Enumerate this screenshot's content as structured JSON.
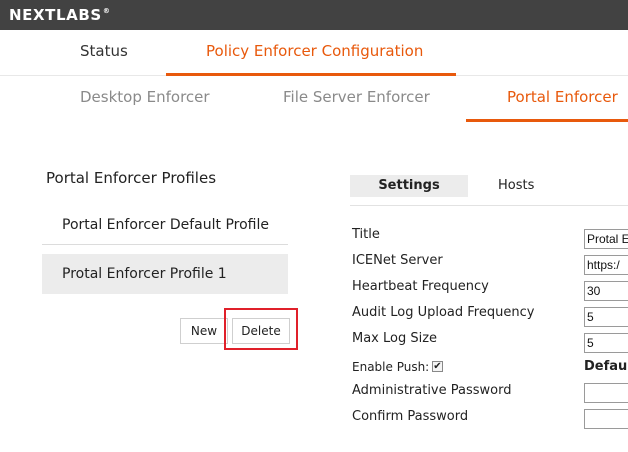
{
  "header": {
    "logo_text": "NEXTLABS",
    "logo_trademark": "®"
  },
  "main_tabs": [
    {
      "label": "Status",
      "active": false
    },
    {
      "label": "Policy Enforcer Configuration",
      "active": true
    }
  ],
  "sub_tabs": [
    {
      "label": "Desktop Enforcer",
      "active": false
    },
    {
      "label": "File Server Enforcer",
      "active": false
    },
    {
      "label": "Portal Enforcer",
      "active": true
    }
  ],
  "profiles": {
    "title": "Portal Enforcer Profiles",
    "items": [
      {
        "label": "Portal Enforcer Default Profile",
        "selected": false
      },
      {
        "label": "Protal Enforcer Profile 1",
        "selected": true
      }
    ],
    "new_label": "New",
    "delete_label": "Delete"
  },
  "settings": {
    "tabs": [
      {
        "label": "Settings",
        "active": true
      },
      {
        "label": "Hosts",
        "active": false
      }
    ],
    "fields": [
      {
        "label": "Title",
        "value": "Protal E"
      },
      {
        "label": "ICENet Server",
        "value": "https:/"
      },
      {
        "label": "Heartbeat Frequency",
        "value": "30"
      },
      {
        "label": "Audit Log Upload Frequency",
        "value": "5"
      },
      {
        "label": "Max Log Size",
        "value": "5"
      },
      {
        "label": "Administrative Password",
        "value": ""
      },
      {
        "label": "Confirm Password",
        "value": ""
      }
    ],
    "enable_push_label": "Enable Push:",
    "enable_push_checked": true,
    "enable_push_checkmark": "✔",
    "default_label": "Defaul"
  },
  "colors": {
    "accent": "#e8590c",
    "topbar": "#424242",
    "highlight": "#e0202a"
  }
}
